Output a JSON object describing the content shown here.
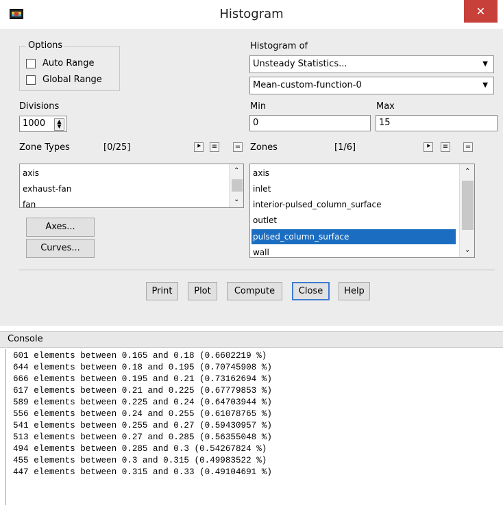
{
  "window": {
    "title": "Histogram",
    "close_glyph": "✕"
  },
  "options": {
    "group_label": "Options",
    "auto_range": "Auto Range",
    "global_range": "Global Range"
  },
  "histogram_of": {
    "label": "Histogram of",
    "category": "Unsteady Statistics...",
    "field": "Mean-custom-function-0"
  },
  "divisions": {
    "label": "Divisions",
    "value": "1000"
  },
  "min": {
    "label": "Min",
    "value": "0"
  },
  "max": {
    "label": "Max",
    "value": "15"
  },
  "zone_types": {
    "label": "Zone Types",
    "count": "[0/25]",
    "items": [
      "axis",
      "exhaust-fan",
      "fan"
    ]
  },
  "zones": {
    "label": "Zones",
    "count": "[1/6]",
    "items": [
      "axis",
      "inlet",
      "interior-pulsed_column_surface",
      "outlet",
      "pulsed_column_surface",
      "wall"
    ],
    "selected": "pulsed_column_surface"
  },
  "side_buttons": {
    "axes": "Axes...",
    "curves": "Curves..."
  },
  "footer_buttons": {
    "print": "Print",
    "plot": "Plot",
    "compute": "Compute",
    "close": "Close",
    "help": "Help"
  },
  "console": {
    "label": "Console",
    "lines": [
      "601 elements between 0.165 and 0.18 (0.6602219 %)",
      "644 elements between 0.18 and 0.195 (0.70745908 %)",
      "666 elements between 0.195 and 0.21 (0.73162694 %)",
      "617 elements between 0.21 and 0.225 (0.67779853 %)",
      "589 elements between 0.225 and 0.24 (0.64703944 %)",
      "556 elements between 0.24 and 0.255 (0.61078765 %)",
      "541 elements between 0.255 and 0.27 (0.59430957 %)",
      "513 elements between 0.27 and 0.285 (0.56355048 %)",
      "494 elements between 0.285 and 0.3 (0.54267824 %)",
      "455 elements between 0.3 and 0.315 (0.49983522 %)",
      "447 elements between 0.315 and 0.33 (0.49104691 %)"
    ]
  }
}
